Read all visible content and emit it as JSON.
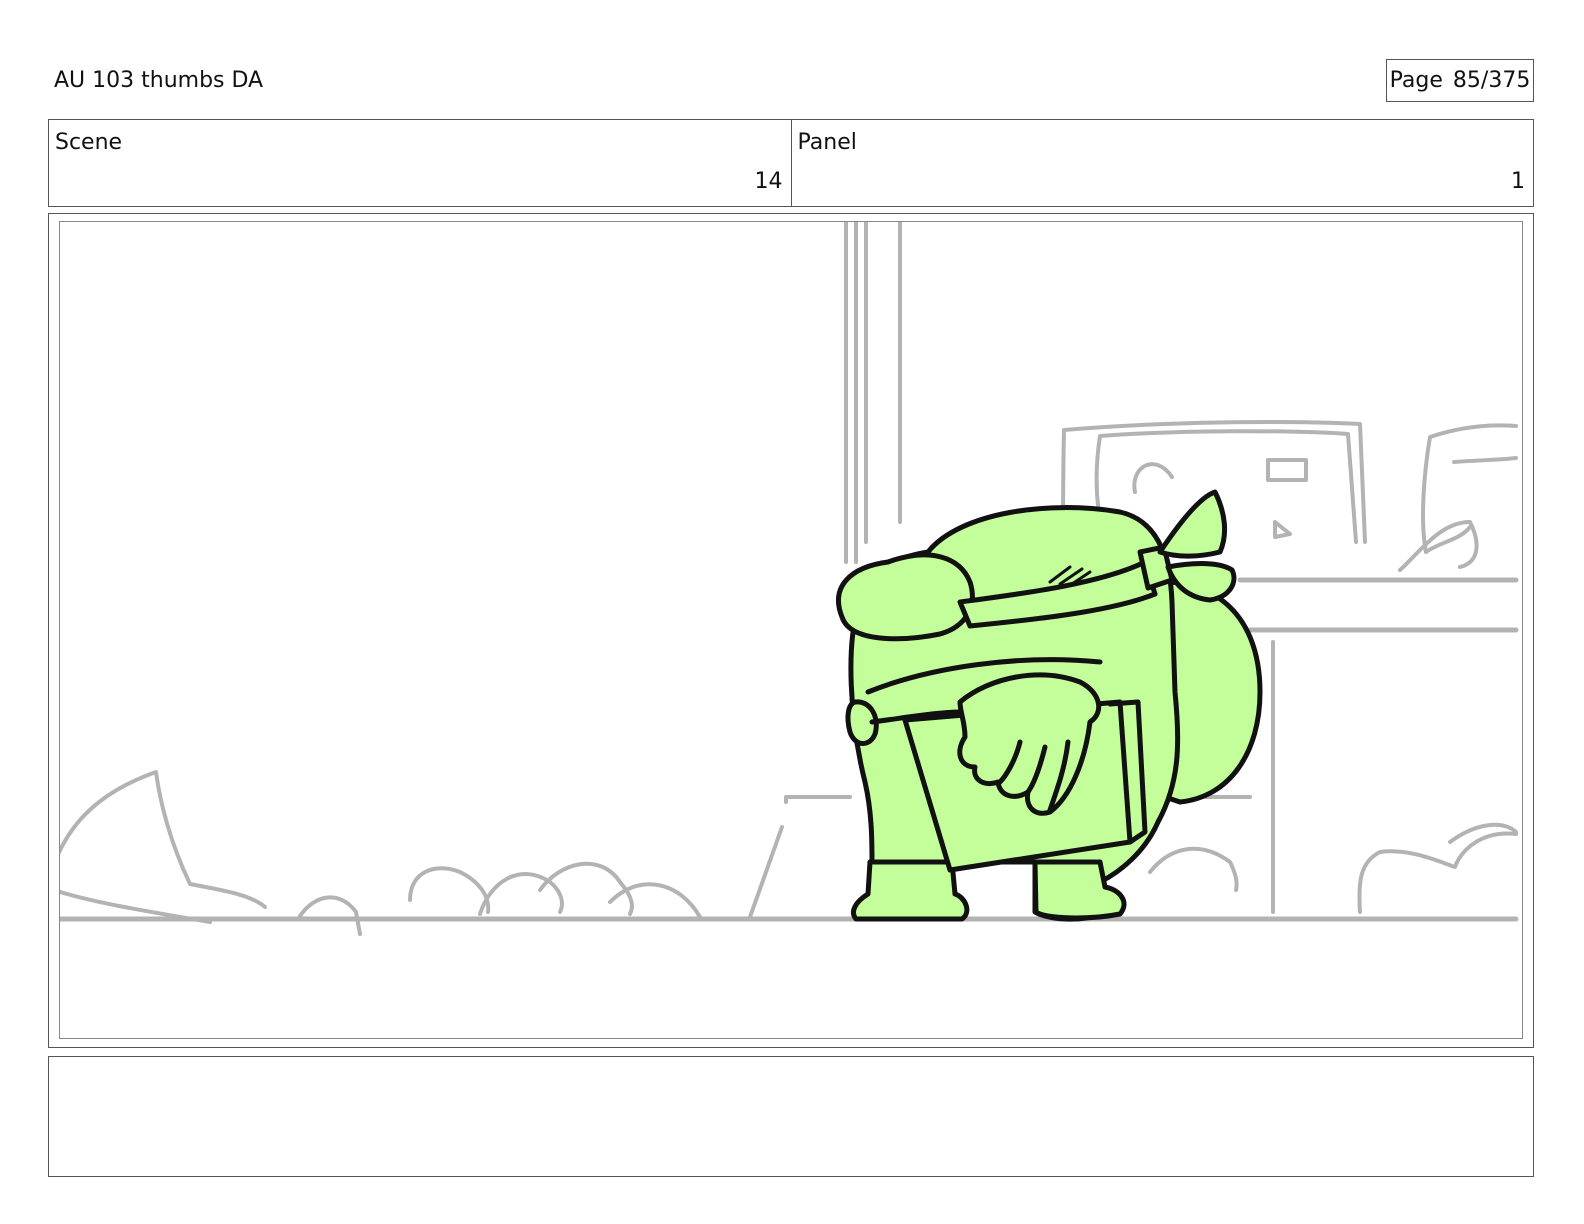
{
  "header": {
    "title": "AU 103 thumbs DA",
    "page_label": "Page",
    "page_value": "85/375"
  },
  "info": {
    "scene_label": "Scene",
    "scene_value": "14",
    "panel_label": "Panel",
    "panel_value": "1"
  },
  "drawing": {
    "subject": "green-character-with-backpack-sketch",
    "character_fill": "#c4fe9a",
    "line_color": "#111111",
    "background_sketch_color": "#b3b3b3"
  },
  "notes": {
    "text": ""
  }
}
